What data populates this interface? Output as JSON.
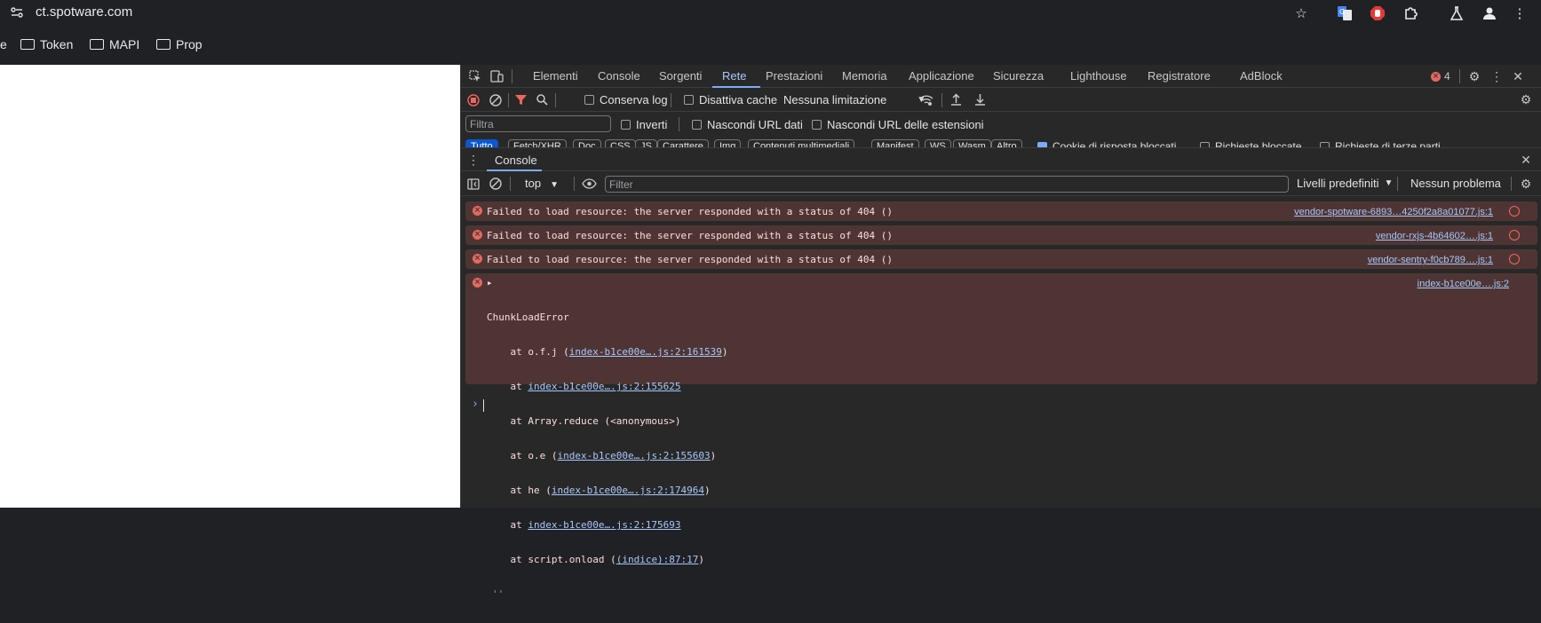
{
  "browser": {
    "url": "ct.spotware.com",
    "bookmarks": [
      {
        "label": "e"
      },
      {
        "label": "Token"
      },
      {
        "label": "MAPI"
      },
      {
        "label": "Prop"
      }
    ]
  },
  "devtools": {
    "tabs": [
      "Elementi",
      "Console",
      "Sorgenti",
      "Rete",
      "Prestazioni",
      "Memoria",
      "Applicazione",
      "Sicurezza",
      "Lighthouse",
      "Registratore",
      "AdBlock"
    ],
    "active_tab": "Rete",
    "error_count": "4",
    "network": {
      "preserve_log": "Conserva log",
      "disable_cache": "Disattiva cache",
      "throttling": "Nessuna limitazione",
      "filter_placeholder": "Filtra",
      "invert": "Inverti",
      "hide_data_urls": "Nascondi URL dati",
      "hide_extension_urls": "Nascondi URL delle estensioni",
      "chips": [
        "Tutto",
        "Fetch/XHR",
        "Doc",
        "CSS",
        "JS",
        "Carattere",
        "Img",
        "Contenuti multimediali",
        "Manifest",
        "WS",
        "Wasm",
        "Altro"
      ],
      "blocked_cookies": "Cookie di risposta bloccati",
      "blocked_requests": "Richieste bloccate",
      "third_party": "Richieste di terze parti"
    },
    "drawer": {
      "tab": "Console"
    },
    "console": {
      "context": "top",
      "filter_placeholder": "Filter",
      "levels": "Livelli predefiniti",
      "issues": "Nessun problema",
      "messages": [
        {
          "text": "Failed to load resource: the server responded with a status of 404 ()",
          "source": "vendor-spotware-6893…4250f2a8a01077.js:1"
        },
        {
          "text": "Failed to load resource: the server responded with a status of 404 ()",
          "source": "vendor-rxjs-4b64602….js:1"
        },
        {
          "text": "Failed to load resource: the server responded with a status of 404 ()",
          "source": "vendor-sentry-f0cb789….js:1"
        }
      ],
      "chunk_error": {
        "source": "index-b1ce00e….js:2",
        "title": "ChunkLoadError",
        "lines": [
          {
            "pre": "    at o.f.j (",
            "link": "index-b1ce00e….js:2:161539",
            "post": ")"
          },
          {
            "pre": "    at ",
            "link": "index-b1ce00e….js:2:155625",
            "post": ""
          },
          {
            "pre": "    at Array.reduce (<anonymous>)",
            "link": "",
            "post": ""
          },
          {
            "pre": "    at o.e (",
            "link": "index-b1ce00e….js:2:155603",
            "post": ")"
          },
          {
            "pre": "    at he (",
            "link": "index-b1ce00e….js:2:174964",
            "post": ")"
          },
          {
            "pre": "    at ",
            "link": "index-b1ce00e….js:2:175693",
            "post": ""
          },
          {
            "pre": "    at script.onload (",
            "link": "(indice):87:17",
            "post": ")"
          }
        ],
        "tail": "''"
      },
      "prompt": "›"
    }
  },
  "colors": {
    "accent": "#7cacf8",
    "error_bg": "#4e3534",
    "error_icon": "#e46962"
  }
}
